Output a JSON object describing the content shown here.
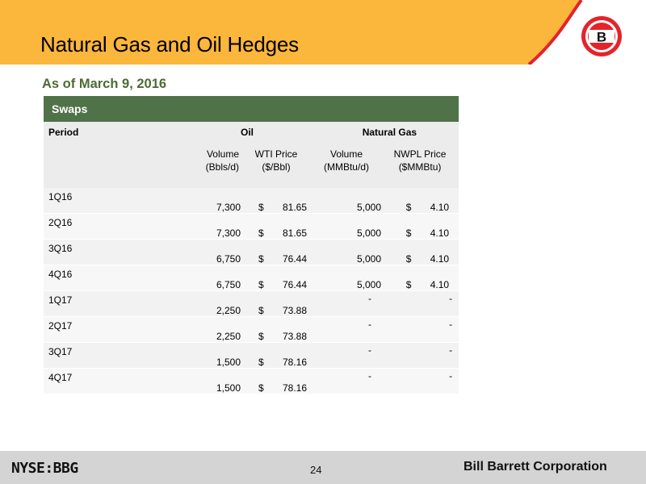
{
  "header": {
    "title": "Natural Gas and Oil Hedges",
    "accent_color": "#fbb63c",
    "logo_letter": "B",
    "logo_color": "#e3242b"
  },
  "subtitle": "As of March 9, 2016",
  "table": {
    "section_label": "Swaps",
    "col_period": "Period",
    "group_oil": "Oil",
    "group_gas": "Natural Gas",
    "units": {
      "oil_volume": [
        "Volume",
        "(Bbls/d)"
      ],
      "oil_price": [
        "WTI Price",
        "($/Bbl)"
      ],
      "gas_volume": [
        "Volume",
        "(MMBtu/d)"
      ],
      "gas_price": [
        "NWPL Price",
        "($MMBtu)"
      ]
    },
    "rows": [
      {
        "period": "1Q16",
        "oil_volume": "7,300",
        "oil_cur": "$",
        "oil_price": "81.65",
        "gas_volume": "5,000",
        "gas_cur": "$",
        "gas_price": "4.10"
      },
      {
        "period": "2Q16",
        "oil_volume": "7,300",
        "oil_cur": "$",
        "oil_price": "81.65",
        "gas_volume": "5,000",
        "gas_cur": "$",
        "gas_price": "4.10"
      },
      {
        "period": "3Q16",
        "oil_volume": "6,750",
        "oil_cur": "$",
        "oil_price": "76.44",
        "gas_volume": "5,000",
        "gas_cur": "$",
        "gas_price": "4.10"
      },
      {
        "period": "4Q16",
        "oil_volume": "6,750",
        "oil_cur": "$",
        "oil_price": "76.44",
        "gas_volume": "5,000",
        "gas_cur": "$",
        "gas_price": "4.10"
      },
      {
        "period": "1Q17",
        "oil_volume": "2,250",
        "oil_cur": "$",
        "oil_price": "73.88",
        "gas_volume": "-",
        "gas_cur": "",
        "gas_price": "-"
      },
      {
        "period": "2Q17",
        "oil_volume": "2,250",
        "oil_cur": "$",
        "oil_price": "73.88",
        "gas_volume": "-",
        "gas_cur": "",
        "gas_price": "-"
      },
      {
        "period": "3Q17",
        "oil_volume": "1,500",
        "oil_cur": "$",
        "oil_price": "78.16",
        "gas_volume": "-",
        "gas_cur": "",
        "gas_price": "-"
      },
      {
        "period": "4Q17",
        "oil_volume": "1,500",
        "oil_cur": "$",
        "oil_price": "78.16",
        "gas_volume": "-",
        "gas_cur": "",
        "gas_price": "-"
      }
    ]
  },
  "footer": {
    "ticker": "NYSE:BBG",
    "page_number": "24",
    "company": "Bill Barrett Corporation"
  }
}
